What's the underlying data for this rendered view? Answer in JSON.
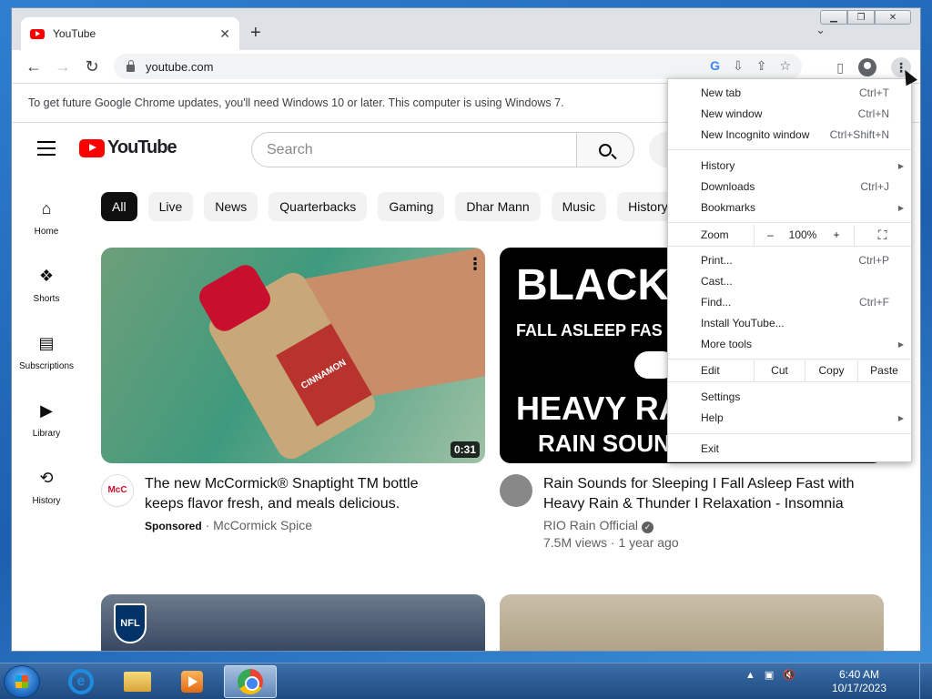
{
  "browser": {
    "tab_title": "YouTube",
    "url": "youtube.com",
    "new_tab_symbol": "+",
    "infobar_text": "To get future Google Chrome updates, you'll need Windows 10 or later. This computer is using Windows 7."
  },
  "youtube": {
    "logo_text": "YouTube",
    "search_placeholder": "Search",
    "sidebar": [
      {
        "label": "Home",
        "icon": "home-icon"
      },
      {
        "label": "Shorts",
        "icon": "shorts-icon"
      },
      {
        "label": "Subscriptions",
        "icon": "subscriptions-icon"
      },
      {
        "label": "Library",
        "icon": "library-icon"
      },
      {
        "label": "History",
        "icon": "history-icon"
      }
    ],
    "chips": [
      "All",
      "Live",
      "News",
      "Quarterbacks",
      "Gaming",
      "Dhar Mann",
      "Music",
      "History"
    ],
    "videos": [
      {
        "title": "The new McCormick® Snaptight TM bottle keeps flavor fresh, and meals delicious.",
        "sponsored_label": "Sponsored",
        "channel": "McCormick Spice",
        "duration": "0:31",
        "thumb_label": "CINNAMON"
      },
      {
        "title": "Rain Sounds for Sleeping I Fall Asleep Fast with Heavy Rain & Thunder I Relaxation - Insomnia",
        "channel": "RIO Rain Official",
        "views_age": "7.5M views · 1 year ago",
        "thumb_line1": "BLACK",
        "thumb_line2": "FALL ASLEEP FAS",
        "thumb_line3": "HEAVY RAI",
        "thumb_line4": "RAIN SOUND"
      }
    ],
    "nfl_badge": "NFL"
  },
  "menu": {
    "new_tab": {
      "label": "New tab",
      "shortcut": "Ctrl+T"
    },
    "new_window": {
      "label": "New window",
      "shortcut": "Ctrl+N"
    },
    "new_incognito": {
      "label": "New Incognito window",
      "shortcut": "Ctrl+Shift+N"
    },
    "history": {
      "label": "History"
    },
    "downloads": {
      "label": "Downloads",
      "shortcut": "Ctrl+J"
    },
    "bookmarks": {
      "label": "Bookmarks"
    },
    "zoom": {
      "label": "Zoom",
      "minus": "–",
      "value": "100%",
      "plus": "+"
    },
    "print": {
      "label": "Print...",
      "shortcut": "Ctrl+P"
    },
    "cast": {
      "label": "Cast..."
    },
    "find": {
      "label": "Find...",
      "shortcut": "Ctrl+F"
    },
    "install": {
      "label": "Install YouTube..."
    },
    "more_tools": {
      "label": "More tools"
    },
    "edit": {
      "label": "Edit",
      "cut": "Cut",
      "copy": "Copy",
      "paste": "Paste"
    },
    "settings": {
      "label": "Settings"
    },
    "help": {
      "label": "Help"
    },
    "exit": {
      "label": "Exit"
    }
  },
  "taskbar": {
    "time": "6:40 AM",
    "date": "10/17/2023"
  }
}
